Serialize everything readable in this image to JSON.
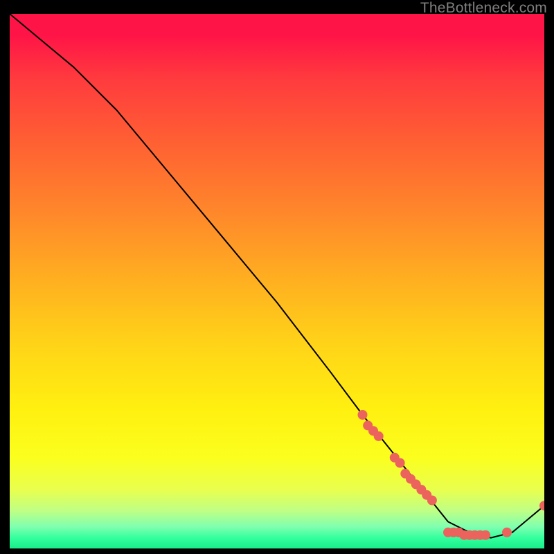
{
  "watermark": "TheBottleneck.com",
  "chart_data": {
    "type": "line",
    "title": "",
    "xlabel": "",
    "ylabel": "",
    "xlim": [
      0,
      100
    ],
    "ylim": [
      0,
      100
    ],
    "grid": false,
    "legend": false,
    "curve": {
      "name": "bottleneck-curve",
      "color": "#000000",
      "x": [
        0,
        6,
        12,
        20,
        30,
        40,
        50,
        60,
        66,
        70,
        74,
        78,
        82,
        86,
        90,
        94,
        100
      ],
      "y": [
        100,
        95,
        90,
        82,
        70,
        58,
        46,
        33,
        25,
        20,
        15,
        10,
        5,
        3,
        2,
        3,
        8
      ]
    },
    "markers": {
      "name": "data-points",
      "color": "#ec625c",
      "radius": 7,
      "points": [
        {
          "x": 66,
          "y": 25
        },
        {
          "x": 67,
          "y": 23
        },
        {
          "x": 68,
          "y": 22
        },
        {
          "x": 69,
          "y": 21
        },
        {
          "x": 72,
          "y": 17
        },
        {
          "x": 73,
          "y": 16
        },
        {
          "x": 74,
          "y": 14
        },
        {
          "x": 75,
          "y": 13
        },
        {
          "x": 76,
          "y": 12
        },
        {
          "x": 77,
          "y": 11
        },
        {
          "x": 78,
          "y": 10
        },
        {
          "x": 79,
          "y": 9
        },
        {
          "x": 82,
          "y": 3
        },
        {
          "x": 83,
          "y": 3
        },
        {
          "x": 84,
          "y": 3
        },
        {
          "x": 85,
          "y": 2.5
        },
        {
          "x": 86,
          "y": 2.5
        },
        {
          "x": 87,
          "y": 2.5
        },
        {
          "x": 88,
          "y": 2.5
        },
        {
          "x": 89,
          "y": 2.5
        },
        {
          "x": 93,
          "y": 3
        },
        {
          "x": 100,
          "y": 8
        }
      ]
    }
  }
}
